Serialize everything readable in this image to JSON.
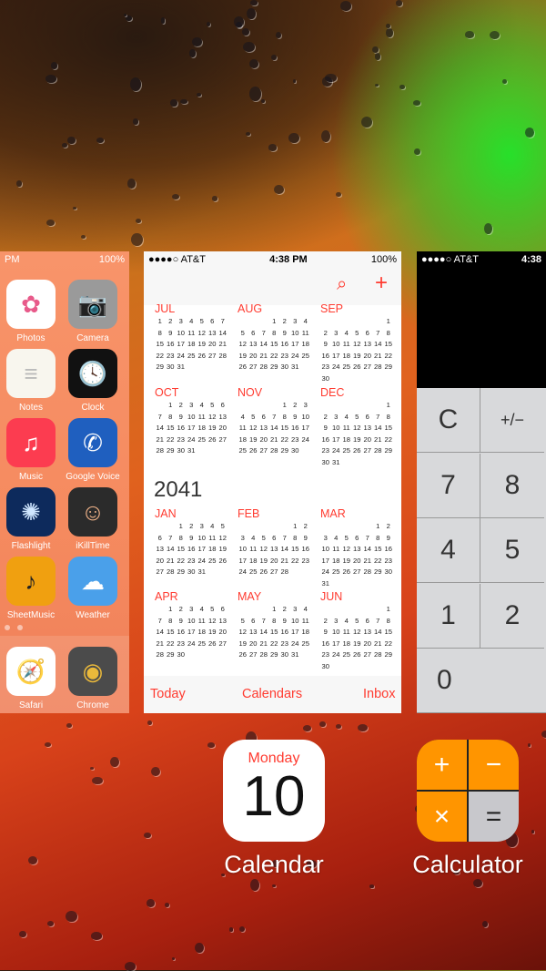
{
  "home_card": {
    "status": {
      "time": "PM",
      "battery": "100%"
    },
    "apps": [
      {
        "label": "Photos",
        "icon": "photos-icon",
        "color": "#ffffff",
        "glyph": "✿",
        "gcolor": "#e85a8a"
      },
      {
        "label": "Camera",
        "icon": "camera-icon",
        "color": "#9a9a9a",
        "glyph": "📷",
        "gcolor": "#222"
      },
      {
        "label": "Notes",
        "icon": "notes-icon",
        "color": "#f8f6ee",
        "glyph": "≡",
        "gcolor": "#bbb"
      },
      {
        "label": "Clock",
        "icon": "clock-icon",
        "color": "#111111",
        "glyph": "🕓",
        "gcolor": "#fff"
      },
      {
        "label": "Music",
        "icon": "music-icon",
        "color": "#fc3c50",
        "glyph": "♫",
        "gcolor": "#fff"
      },
      {
        "label": "Google Voice",
        "icon": "google-voice-icon",
        "color": "#1f5fbf",
        "glyph": "✆",
        "gcolor": "#fff"
      },
      {
        "label": "Flashlight",
        "icon": "flashlight-icon",
        "color": "#0d2a5c",
        "glyph": "✺",
        "gcolor": "#cfe6ff"
      },
      {
        "label": "iKillTime",
        "icon": "ikilltime-icon",
        "color": "#2b2b2b",
        "glyph": "☺",
        "gcolor": "#f2b48a"
      },
      {
        "label": "SheetMusic",
        "icon": "sheetmusic-icon",
        "color": "#f0a010",
        "glyph": "♪",
        "gcolor": "#222"
      },
      {
        "label": "Weather",
        "icon": "weather-icon",
        "color": "#4aa0ea",
        "glyph": "☁",
        "gcolor": "#fff"
      }
    ],
    "dock": [
      {
        "label": "Safari",
        "icon": "safari-icon",
        "color": "#ffffff",
        "glyph": "🧭",
        "gcolor": "#1e88e5"
      },
      {
        "label": "Chrome",
        "icon": "chrome-icon",
        "color": "#333333",
        "glyph": "◉",
        "gcolor": "#e8b020"
      }
    ]
  },
  "calendar_card": {
    "status": {
      "carrier": "●●●●○ AT&T",
      "time": "4:38 PM",
      "battery": "100%"
    },
    "search_icon": "⌕",
    "add_icon": "+",
    "year": "2041",
    "months": [
      {
        "name": "JUL",
        "start": 0,
        "days": 31
      },
      {
        "name": "AUG",
        "start": 3,
        "days": 31
      },
      {
        "name": "SEP",
        "start": 6,
        "days": 30
      },
      {
        "name": "OCT",
        "start": 1,
        "days": 31
      },
      {
        "name": "NOV",
        "start": 4,
        "days": 30
      },
      {
        "name": "DEC",
        "start": 6,
        "days": 31
      },
      {
        "name": "JAN",
        "start": 2,
        "days": 31
      },
      {
        "name": "FEB",
        "start": 5,
        "days": 28
      },
      {
        "name": "MAR",
        "start": 5,
        "days": 31
      },
      {
        "name": "APR",
        "start": 1,
        "days": 30
      },
      {
        "name": "MAY",
        "start": 3,
        "days": 31
      },
      {
        "name": "JUN",
        "start": 6,
        "days": 30
      }
    ],
    "toolbar": {
      "today": "Today",
      "calendars": "Calendars",
      "inbox": "Inbox"
    },
    "accent": "#ff3b30"
  },
  "calculator_card": {
    "status": {
      "carrier": "●●●●○ AT&T",
      "time": "4:38"
    },
    "keys": [
      "C",
      "+/−",
      "7",
      "8",
      "4",
      "5",
      "1",
      "2",
      "0"
    ]
  },
  "switcher": {
    "calendar": {
      "label": "Calendar",
      "weekday": "Monday",
      "day": "10"
    },
    "calculator": {
      "label": "Calculator",
      "symbols": [
        "+",
        "−",
        "×",
        "="
      ],
      "color": "#ff9500"
    }
  }
}
